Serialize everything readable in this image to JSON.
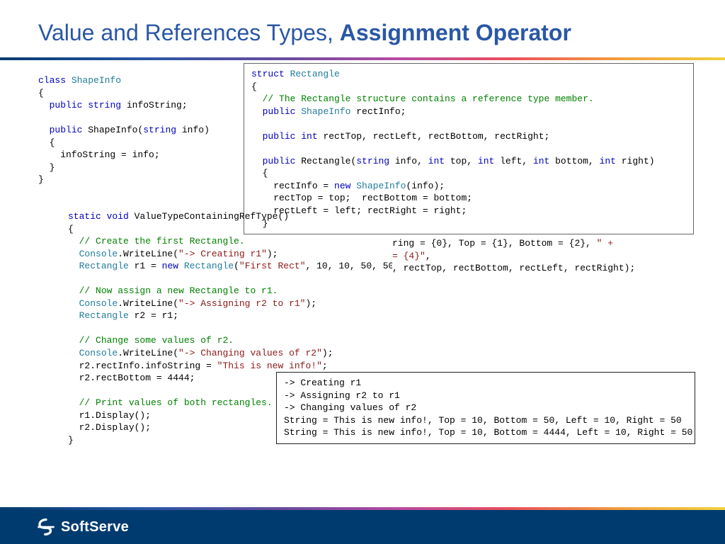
{
  "title": {
    "light": "Value and References Types, ",
    "bold": "Assignment Operator"
  },
  "code_shapeinfo": "class ShapeInfo\n{\n  public string infoString;\n\n  public ShapeInfo(string info)\n  {\n    infoString = info;\n  }\n}",
  "code_shapeinfo_hl": "<span class=\"kw\">class</span> <span class=\"type\">ShapeInfo</span>\n{\n  <span class=\"kw\">public</span> <span class=\"kw\">string</span> infoString;\n\n  <span class=\"kw\">public</span> ShapeInfo(<span class=\"kw\">string</span> info)\n  {\n    infoString = info;\n  }\n}",
  "code_struct_hl": "<span class=\"kw\">struct</span> <span class=\"type\">Rectangle</span>\n{\n  <span class=\"com\">// The Rectangle structure contains a reference type member.</span>\n  <span class=\"kw\">public</span> <span class=\"type\">ShapeInfo</span> rectInfo;\n\n  <span class=\"kw\">public</span> <span class=\"kw\">int</span> rectTop, rectLeft, rectBottom, rectRight;\n\n  <span class=\"kw\">public</span> Rectangle(<span class=\"kw\">string</span> info, <span class=\"kw\">int</span> top, <span class=\"kw\">int</span> left, <span class=\"kw\">int</span> bottom, <span class=\"kw\">int</span> right)\n  {\n    rectInfo = <span class=\"kw\">new</span> <span class=\"type\">ShapeInfo</span>(info);\n    rectTop = top;  rectBottom = bottom;\n    rectLeft = left; rectRight = right;\n  }",
  "code_overlap_hl": "ring = {0}, Top = {1}, Bottom = {2}, <span class=\"str\">\" +\n= {4}\"</span>,\n, rectTop, rectBottom, rectLeft, rectRight);",
  "code_method_hl": "<span class=\"kw\">static</span> <span class=\"kw\">void</span> ValueTypeContainingRefType()\n{\n  <span class=\"com\">// Create the first Rectangle.</span>\n  <span class=\"type\">Console</span>.WriteLine(<span class=\"str\">\"-> Creating r1\"</span>);\n  <span class=\"type\">Rectangle</span> r1 = <span class=\"kw\">new</span> <span class=\"type\">Rectangle</span>(<span class=\"str\">\"First Rect\"</span>, 10, 10, 50, 50);\n\n  <span class=\"com\">// Now assign a new Rectangle to r1.</span>\n  <span class=\"type\">Console</span>.WriteLine(<span class=\"str\">\"-> Assigning r2 to r1\"</span>);\n  <span class=\"type\">Rectangle</span> r2 = r1;\n\n  <span class=\"com\">// Change some values of r2.</span>\n  <span class=\"type\">Console</span>.WriteLine(<span class=\"str\">\"-> Changing values of r2\"</span>);\n  r2.rectInfo.infoString = <span class=\"str\">\"This is new info!\"</span>;\n  r2.rectBottom = 4444;\n\n  <span class=\"com\">// Print values of both rectangles.</span>\n  r1.Display();\n  r2.Display();\n}",
  "output": "-> Creating r1\n-> Assigning r2 to r1\n-> Changing values of r2\nString = This is new info!, Top = 10, Bottom = 50, Left = 10, Right = 50\nString = This is new info!, Top = 10, Bottom = 4444, Left = 10, Right = 50",
  "footer": {
    "brand": "SoftServe"
  }
}
